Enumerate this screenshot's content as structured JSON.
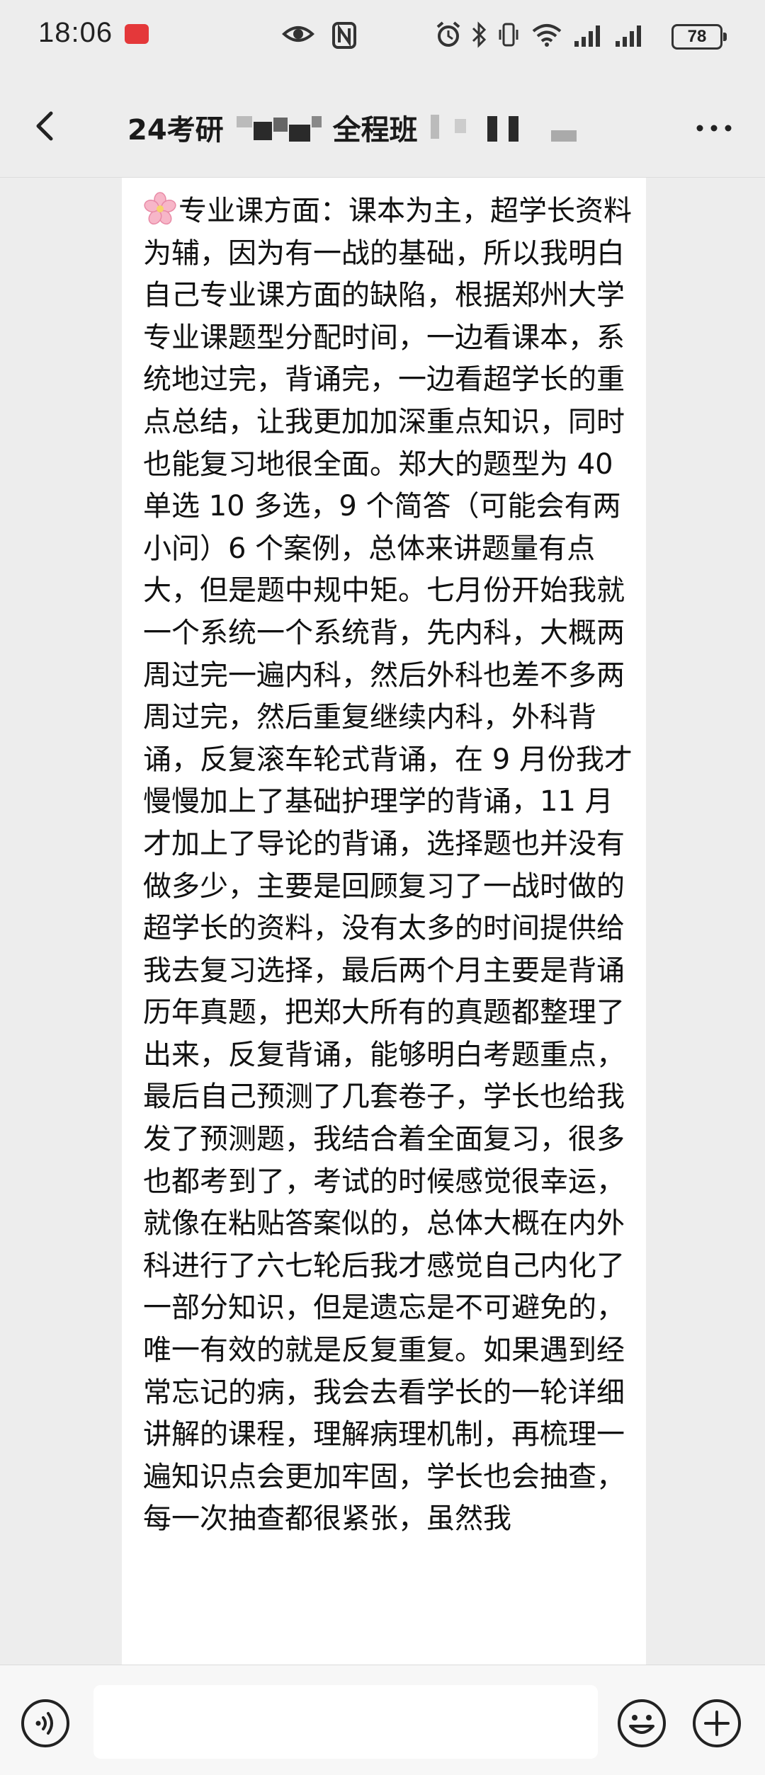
{
  "status_bar": {
    "time": "18:06",
    "battery": "78",
    "icons": [
      "eye-icon",
      "nfc-icon",
      "alarm-icon",
      "bluetooth-icon",
      "vibrate-icon",
      "wifi-icon",
      "signal-icon",
      "signal-icon"
    ]
  },
  "header": {
    "title_prefix": "24考研",
    "title_mid": "全程班",
    "back_icon": "chevron-left-icon",
    "more_icon": "more-dots-icon"
  },
  "message": {
    "emoji": "cherry-blossom-icon",
    "text": "专业课方面：课本为主，超学长资料为辅，因为有一战的基础，所以我明白自己专业课方面的缺陷，根据郑州大学专业课题型分配时间，一边看课本，系统地过完，背诵完，一边看超学长的重点总结，让我更加加深重点知识，同时也能复习地很全面。郑大的题型为 40 单选 10 多选，9 个简答（可能会有两小问）6 个案例，总体来讲题量有点大，但是题中规中矩。七月份开始我就一个系统一个系统背，先内科，大概两周过完一遍内科，然后外科也差不多两周过完，然后重复继续内科，外科背诵，反复滚车轮式背诵，在 9 月份我才慢慢加上了基础护理学的背诵，11 月才加上了导论的背诵，选择题也并没有做多少，主要是回顾复习了一战时做的超学长的资料，没有太多的时间提供给我去复习选择，最后两个月主要是背诵历年真题，把郑大所有的真题都整理了出来，反复背诵，能够明白考题重点，最后自己预测了几套卷子，学长也给我发了预测题，我结合着全面复习，很多也都考到了，考试的时候感觉很幸运，就像在粘贴答案似的，总体大概在内外科进行了六七轮后我才感觉自己内化了一部分知识，但是遗忘是不可避免的，唯一有效的就是反复重复。如果遇到经常忘记的病，我会去看学长的一轮详细讲解的课程，理解病理机制，再梳理一遍知识点会更加牢固，学长也会抽查，每一次抽查都很紧张，虽然我"
  },
  "input_bar": {
    "voice_icon": "voice-icon",
    "emoji_icon": "smiley-icon",
    "plus_icon": "plus-circle-icon"
  },
  "colors": {
    "background": "#ededed",
    "bubble": "#ffffff",
    "status_red": "#e4383a"
  }
}
